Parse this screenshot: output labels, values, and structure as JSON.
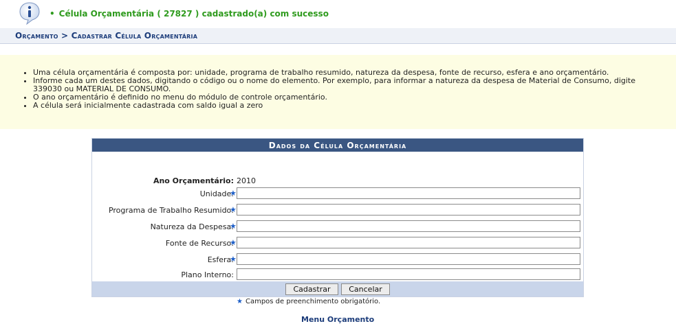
{
  "message": {
    "bullet": "•",
    "text": "Célula Orçamentária ( 27827 ) cadastrado(a) com sucesso"
  },
  "breadcrumb": {
    "text": "Orçamento > Cadastrar Célula Orçamentária"
  },
  "help": {
    "items": [
      "Uma célula orçamentária é composta por: unidade, programa de trabalho resumido, natureza da despesa, fonte de recurso, esfera e ano orçamentário.",
      "Informe cada um destes dados, digitando o código ou o nome do elemento. Por exemplo, para informar a natureza da despesa de Material de Consumo, digite 339030 ou MATERIAL DE CONSUMO.",
      "O ano orçamentário é definido no menu do módulo de controle orçamentário.",
      "A célula será inicialmente cadastrada com saldo igual a zero"
    ]
  },
  "form": {
    "caption": "Dados da Célula Orçamentária",
    "ano_label": "Ano Orçamentário:",
    "ano_value": "2010",
    "fields": [
      {
        "label": "Unidade:",
        "required_mark": "★",
        "value": ""
      },
      {
        "label": "Programa de Trabalho Resumido:",
        "required_mark": "★",
        "value": ""
      },
      {
        "label": "Natureza da Despesa:",
        "required_mark": "★",
        "value": ""
      },
      {
        "label": "Fonte de Recurso:",
        "required_mark": "★",
        "value": ""
      },
      {
        "label": "Esfera:",
        "required_mark": "★",
        "value": ""
      },
      {
        "label": "Plano Interno:",
        "value": ""
      }
    ],
    "buttons": {
      "submit": "Cadastrar",
      "cancel": "Cancelar"
    }
  },
  "required_note": {
    "mark": "★",
    "text": "Campos de preenchimento obrigatório."
  },
  "menu_link": "Menu Orçamento",
  "colors": {
    "success": "#2f9b1e",
    "header_blue": "#3a5682",
    "link_blue": "#1c3c7a",
    "help_bg": "#fdfde3",
    "star": "#1e5fc8"
  }
}
